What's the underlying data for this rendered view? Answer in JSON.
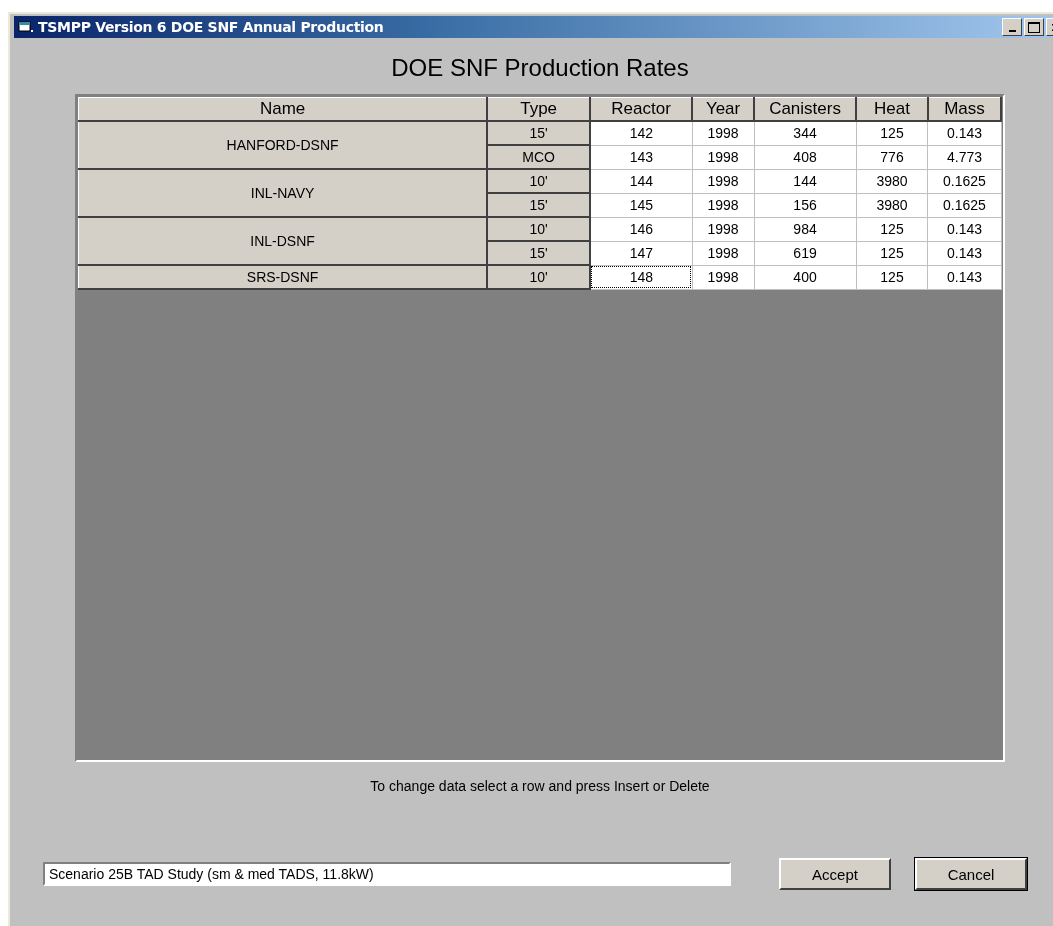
{
  "window": {
    "title": "TSMPP Version 6 DOE SNF Annual Production"
  },
  "heading": "DOE SNF Production Rates",
  "table": {
    "columns": [
      "Name",
      "Type",
      "Reactor",
      "Year",
      "Canisters",
      "Heat",
      "Mass"
    ],
    "groups": [
      {
        "name": "HANFORD-DSNF",
        "rows": [
          {
            "type": "15'",
            "reactor": "142",
            "year": "1998",
            "canisters": "344",
            "heat": "125",
            "mass": "0.143",
            "focused": false
          },
          {
            "type": "MCO",
            "reactor": "143",
            "year": "1998",
            "canisters": "408",
            "heat": "776",
            "mass": "4.773",
            "focused": false
          }
        ]
      },
      {
        "name": "INL-NAVY",
        "rows": [
          {
            "type": "10'",
            "reactor": "144",
            "year": "1998",
            "canisters": "144",
            "heat": "3980",
            "mass": "0.1625",
            "focused": false
          },
          {
            "type": "15'",
            "reactor": "145",
            "year": "1998",
            "canisters": "156",
            "heat": "3980",
            "mass": "0.1625",
            "focused": false
          }
        ]
      },
      {
        "name": "INL-DSNF",
        "rows": [
          {
            "type": "10'",
            "reactor": "146",
            "year": "1998",
            "canisters": "984",
            "heat": "125",
            "mass": "0.143",
            "focused": false
          },
          {
            "type": "15'",
            "reactor": "147",
            "year": "1998",
            "canisters": "619",
            "heat": "125",
            "mass": "0.143",
            "focused": false
          }
        ]
      },
      {
        "name": "SRS-DSNF",
        "rows": [
          {
            "type": "10'",
            "reactor": "148",
            "year": "1998",
            "canisters": "400",
            "heat": "125",
            "mass": "0.143",
            "focused": true
          }
        ]
      }
    ]
  },
  "hint": "To change data select a row and press Insert or Delete",
  "scenario_field": {
    "value": "Scenario 25B TAD Study (sm & med TADS, 11.8kW)"
  },
  "buttons": [
    {
      "label": "Accept",
      "default": false
    },
    {
      "label": "Cancel",
      "default": true
    }
  ]
}
